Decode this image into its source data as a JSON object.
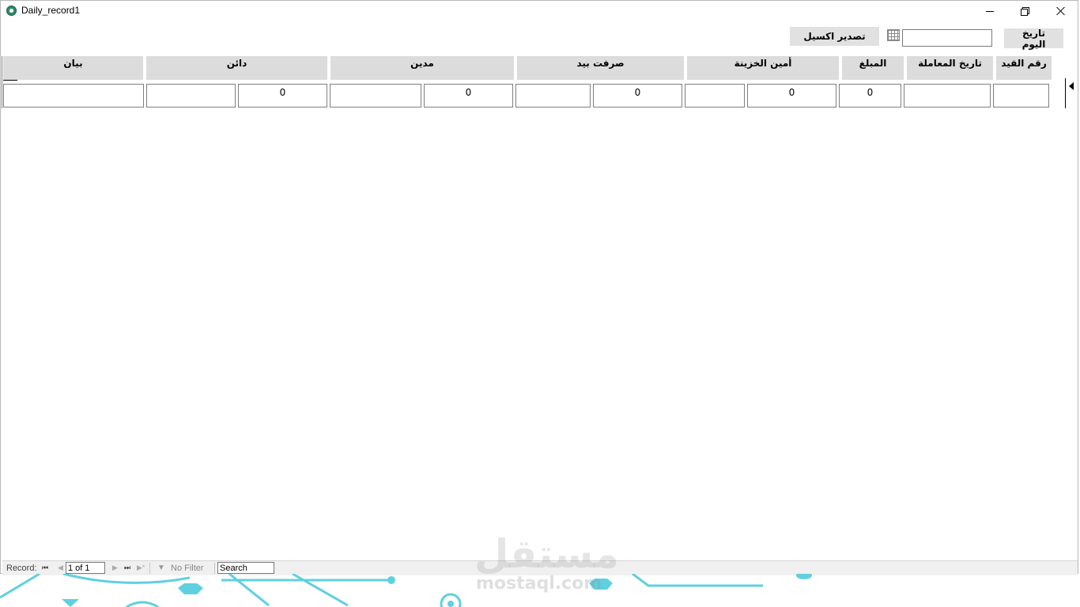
{
  "window": {
    "title": "Daily_record1"
  },
  "header": {
    "today_button": "تاريخ اليوم",
    "export_button": "تصدير اكسيل",
    "date_value": ""
  },
  "columns": [
    "رقم القيد",
    "تاريخ المعاملة",
    "المبلغ",
    "أمين الخزينة",
    "صرفت بيد",
    "مدين",
    "دائن",
    "بيان"
  ],
  "row": {
    "entry_no": "",
    "transaction_date": "",
    "amount": "0",
    "treasurer_id": "0",
    "treasurer_name": "",
    "paid_by_id": "0",
    "paid_by_name": "",
    "debit_id": "0",
    "debit_name": "",
    "credit_id": "0",
    "credit_name": "",
    "description": ""
  },
  "navigation": {
    "record_label": "Record:",
    "position": "1 of 1",
    "filter_label": "No Filter",
    "search_placeholder": "Search"
  },
  "watermark": {
    "arabic": "مستقل",
    "latin": "mostaql.com"
  },
  "colors": {
    "header_bg": "#dcdcdc",
    "button_bg": "#e1e1e1",
    "decoration": "#5fd0e0"
  }
}
